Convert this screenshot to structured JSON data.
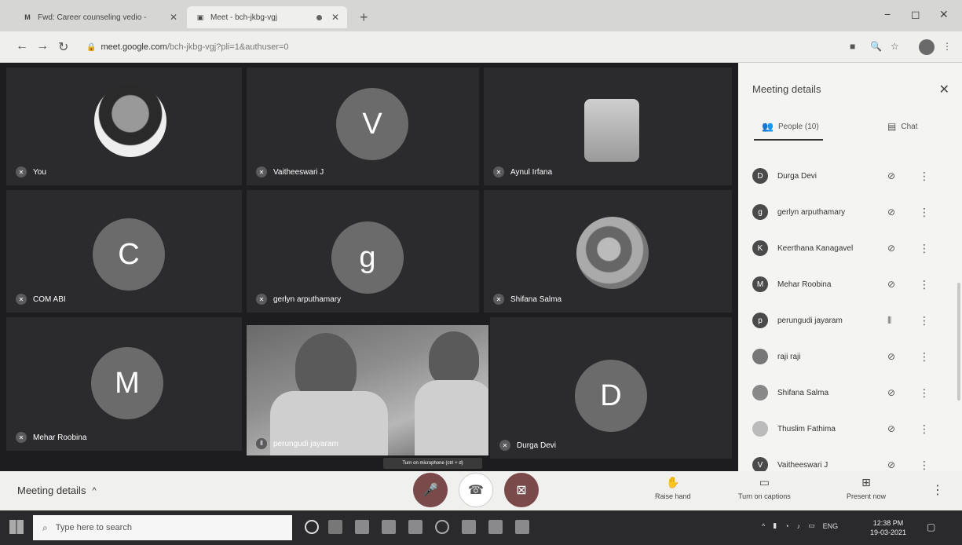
{
  "browser": {
    "tabs": [
      {
        "label": "Fwd: Career counseling vedio - ",
        "favicon": "M"
      },
      {
        "label": "Meet - bch-jkbg-vgj",
        "favicon": "M"
      }
    ],
    "url_host": "meet.google.com",
    "url_path": "/bch-jkbg-vgj?pli=1&authuser=0",
    "new_tab": "+",
    "minimize": "−",
    "maximize": "◻",
    "close": "✕"
  },
  "tiles": [
    {
      "name": "You",
      "type": "photo"
    },
    {
      "name": "Vaitheeswari J",
      "initial": "V",
      "color": "#6b6b6b"
    },
    {
      "name": "Aynul Irfana",
      "type": "fist"
    },
    {
      "name": "COM ABI",
      "initial": "C",
      "color": "#6b6b6b"
    },
    {
      "name": "gerlyn arputhamary",
      "initial": "g",
      "color": "#6b6b6b"
    },
    {
      "name": "Shifana Salma",
      "type": "photo2"
    },
    {
      "name": "Mehar Roobina",
      "initial": "M",
      "color": "#6b6b6b"
    },
    {
      "name": "perungudi jayaram",
      "type": "video"
    },
    {
      "name": "Durga Devi",
      "initial": "D",
      "color": "#6b6b6b"
    }
  ],
  "tooltip": "Turn on microphone (ctrl + d)",
  "panel": {
    "title": "Meeting details",
    "people_tab": "People (10)",
    "chat_tab": "Chat",
    "people": [
      {
        "name": "Durga Devi",
        "initial": "D"
      },
      {
        "name": "gerlyn arputhamary",
        "initial": "g"
      },
      {
        "name": "Keerthana Kanagavel",
        "initial": "K"
      },
      {
        "name": "Mehar Roobina",
        "initial": "M"
      },
      {
        "name": "perungudi jayaram",
        "initial": "p"
      },
      {
        "name": "raji raji",
        "initial": ""
      },
      {
        "name": "Shifana Salma",
        "initial": ""
      },
      {
        "name": "Thuslim Fathima",
        "initial": ""
      },
      {
        "name": "Vaitheeswari J",
        "initial": "V"
      }
    ]
  },
  "controls": {
    "meeting_details": "Meeting details",
    "chevron": "^",
    "raise_hand": "Raise hand",
    "captions": "Turn on captions",
    "present": "Present now"
  },
  "taskbar": {
    "search_placeholder": "Type here to search",
    "lang": "ENG",
    "time": "12:38 PM",
    "date": "19-03-2021"
  }
}
